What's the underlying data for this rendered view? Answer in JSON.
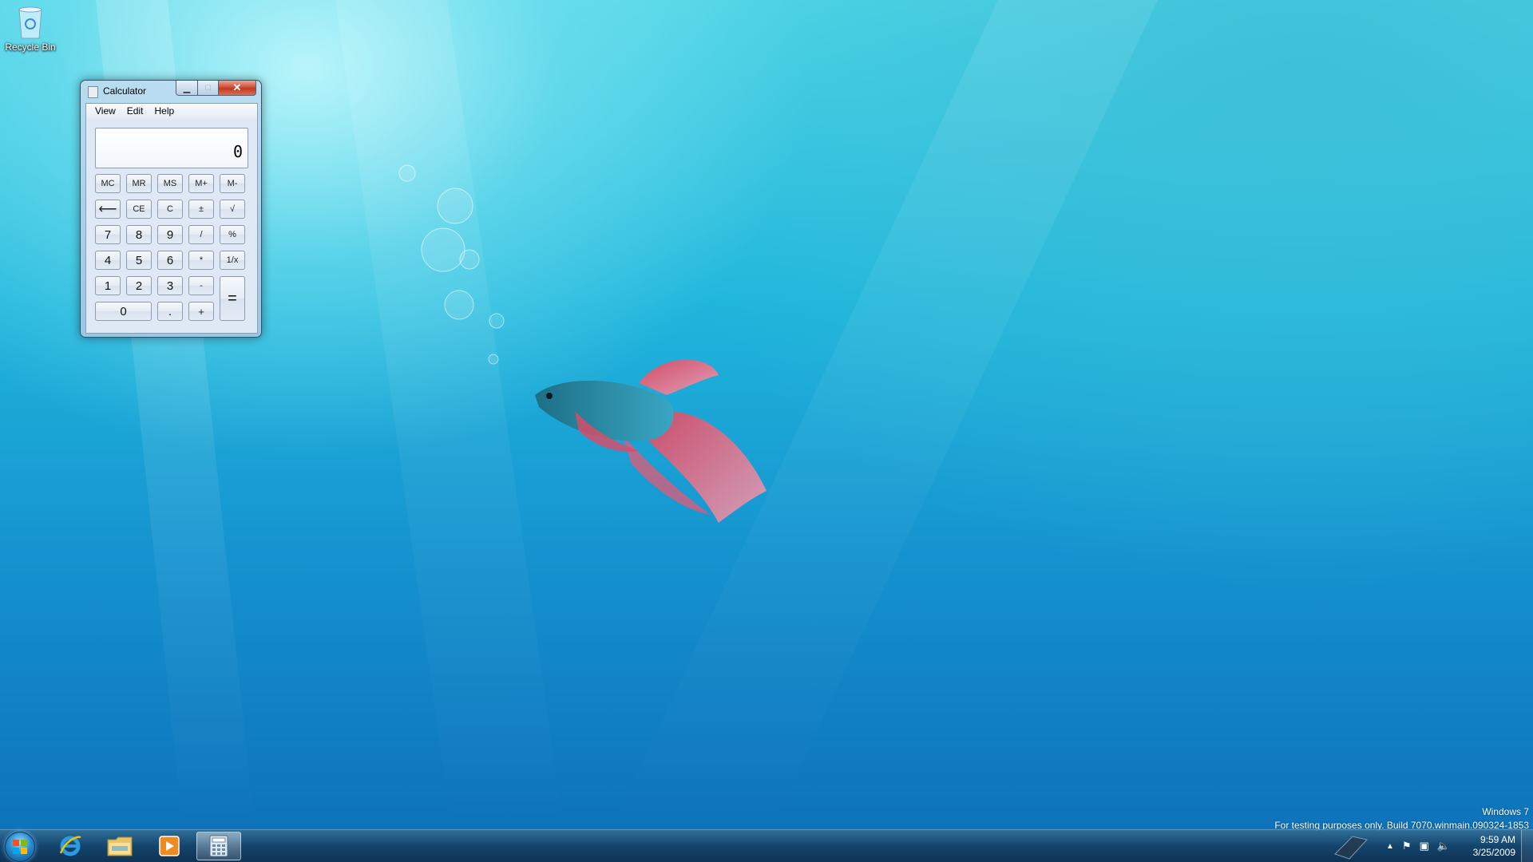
{
  "desktop": {
    "recycle_bin_label": "Recycle Bin"
  },
  "calculator": {
    "title": "Calculator",
    "menu": [
      "View",
      "Edit",
      "Help"
    ],
    "display_value": "0",
    "keys": {
      "mc": "MC",
      "mr": "MR",
      "ms": "MS",
      "mplus": "M+",
      "mminus": "M-",
      "back": "⟵",
      "ce": "CE",
      "c": "C",
      "plusminus": "±",
      "sqrt": "√",
      "seven": "7",
      "eight": "8",
      "nine": "9",
      "divide": "/",
      "percent": "%",
      "four": "4",
      "five": "5",
      "six": "6",
      "multiply": "*",
      "reciprocal": "1/x",
      "one": "1",
      "two": "2",
      "three": "3",
      "minus": "-",
      "equals": "=",
      "zero": "0",
      "decimal": ".",
      "plus": "+"
    }
  },
  "watermark": {
    "line1": "Windows 7",
    "line2": "For testing purposes only. Build 7070.winmain.090324-1853"
  },
  "taskbar": {
    "apps": [
      "start-button",
      "internet-explorer-icon",
      "windows-explorer-icon",
      "media-player-icon",
      "calculator-icon"
    ],
    "clock_time": "9:59 AM",
    "clock_date": "3/25/2009"
  }
}
